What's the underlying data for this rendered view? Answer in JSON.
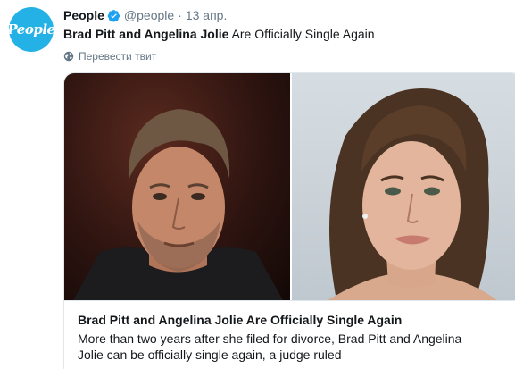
{
  "author": {
    "display_name": "People",
    "handle": "@people",
    "separator": "·",
    "time": "13 апр.",
    "avatar_text": "People"
  },
  "tweet": {
    "text_bold": "Brad Pitt and Angelina Jolie",
    "text_rest": " Are Officially Single Again"
  },
  "translate_label": "Перевести твит",
  "card": {
    "title": "Brad Pitt and Angelina Jolie Are Officially Single Again",
    "description": "More than two years after she filed for divorce, Brad Pitt and Angelina Jolie can be officially single again, a judge ruled"
  },
  "colors": {
    "avatar_bg": "#24b1e6",
    "verified": "#1da1f2",
    "secondary_text": "#657786",
    "card_border": "#e1e8ed"
  },
  "icons": {
    "verified": "verified-badge-icon",
    "translate": "globe-icon"
  }
}
